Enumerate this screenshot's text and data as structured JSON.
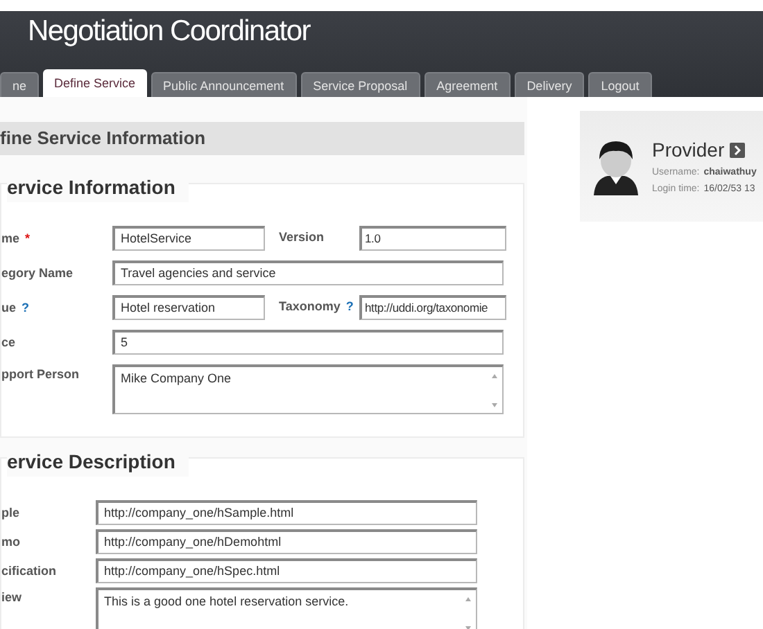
{
  "header": {
    "title": "Negotiation Coordinator"
  },
  "tabs": [
    {
      "label": "ne",
      "selected": false
    },
    {
      "label": "Define Service",
      "selected": true
    },
    {
      "label": "Public Announcement",
      "selected": false
    },
    {
      "label": "Service Proposal",
      "selected": false
    },
    {
      "label": "Agreement",
      "selected": false
    },
    {
      "label": "Delivery",
      "selected": false
    },
    {
      "label": "Logout",
      "selected": false
    }
  ],
  "page_heading": "fine Service Information",
  "sections": [
    {
      "title": "ervice Information",
      "kind": "narrow",
      "rows": [
        {
          "kind": "pair",
          "label": "me",
          "mark": {
            "kind": "required",
            "text": "*"
          },
          "value": "HotelService",
          "second": {
            "label": "Version",
            "value": "1.0"
          }
        },
        {
          "kind": "text",
          "label": "egory Name",
          "value": "Travel agencies and service"
        },
        {
          "kind": "pair",
          "label": "ue",
          "mark": {
            "kind": "help",
            "text": "?"
          },
          "value": "Hotel reservation",
          "second": {
            "label": "Taxonomy",
            "mark": "?",
            "value": "http://uddi.org/taxonomie"
          }
        },
        {
          "kind": "text",
          "label": "ce",
          "value": "5"
        },
        {
          "kind": "textarea",
          "label": "pport Person",
          "value": "Mike Company One"
        }
      ]
    },
    {
      "title": "ervice Description",
      "kind": "wide",
      "rows": [
        {
          "kind": "text",
          "label": "ple",
          "value": "http://company_one/hSample.html"
        },
        {
          "kind": "text",
          "label": "mo",
          "value": "http://company_one/hDemohtml"
        },
        {
          "kind": "text",
          "label": "cification",
          "value": "http://company_one/hSpec.html"
        },
        {
          "kind": "textarea",
          "label": "iew",
          "value": "This is a good one hotel reservation service."
        }
      ]
    }
  ],
  "profile": {
    "role": "Provider",
    "username_label": "Username:",
    "username": "chaiwathuy",
    "login_label": "Login time:",
    "login_time": "16/02/53 13"
  }
}
